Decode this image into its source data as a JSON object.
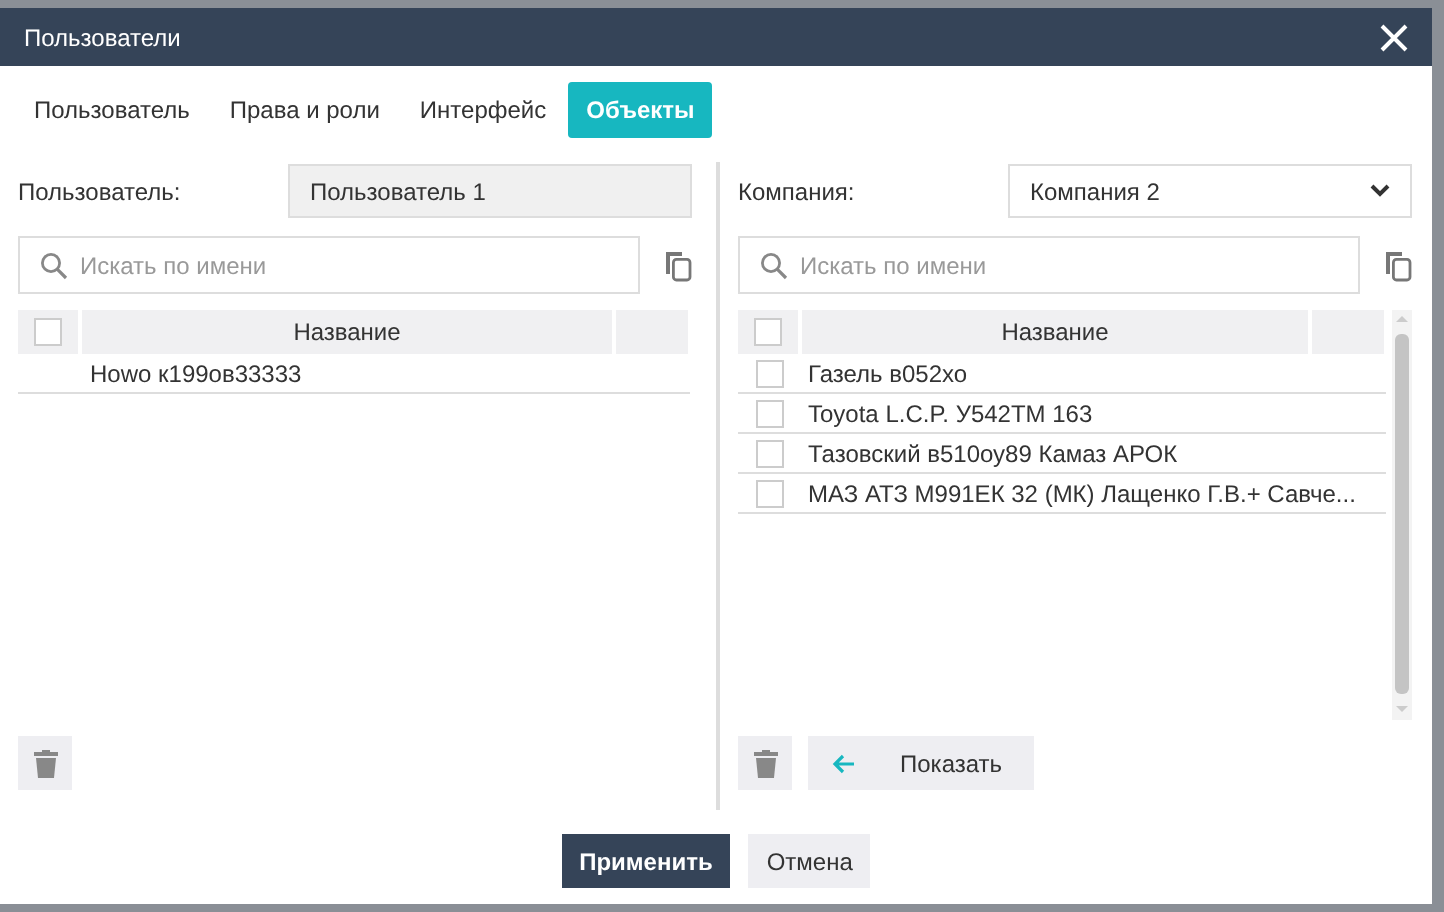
{
  "window": {
    "title": "Пользователи"
  },
  "tabs": [
    {
      "label": "Пользователь",
      "selected": false
    },
    {
      "label": "Права и роли",
      "selected": false
    },
    {
      "label": "Интерфейс",
      "selected": false
    },
    {
      "label": "Объекты",
      "selected": true
    }
  ],
  "left_panel": {
    "field_label": "Пользователь:",
    "field_value": "Пользователь 1",
    "search": {
      "placeholder": "Искать по имени"
    },
    "table": {
      "header_checked": false,
      "columns": [
        "Название"
      ],
      "rows": [
        {
          "name": "Howo к199ов33333"
        }
      ]
    }
  },
  "right_panel": {
    "field_label": "Компания:",
    "field_value": "Компания 2",
    "search": {
      "placeholder": "Искать по имени"
    },
    "table": {
      "header_checked": false,
      "columns": [
        "Название"
      ],
      "rows": [
        {
          "name": "Газель в052хо",
          "checked": false
        },
        {
          "name": "Toyota L.C.P. У542ТМ 163",
          "checked": false
        },
        {
          "name": "Тазовский в510оу89 Камаз АРОК",
          "checked": false
        },
        {
          "name": "МАЗ АТЗ М991ЕК 32 (МК) Лащенко Г.В.+ Савче...",
          "checked": false
        }
      ]
    },
    "show_button": "Показать"
  },
  "buttons": [
    {
      "label": "Применить",
      "kind": "primary"
    },
    {
      "label": "Отмена",
      "kind": "secondary"
    }
  ]
}
